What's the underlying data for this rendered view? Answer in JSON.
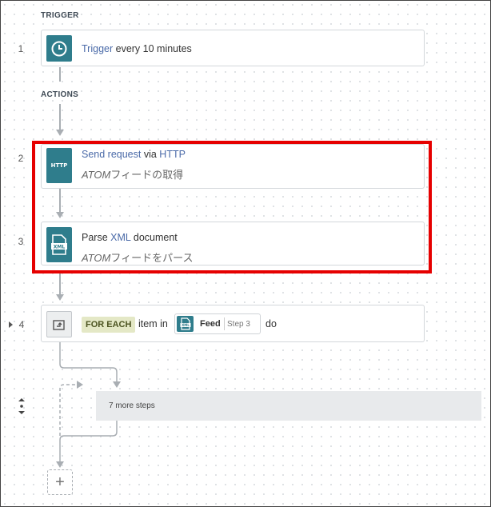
{
  "sections": {
    "trigger_label": "TRIGGER",
    "actions_label": "ACTIONS"
  },
  "steps": [
    {
      "number": "1",
      "icon": "clock-icon",
      "line1": {
        "prefix": "",
        "link1": "Trigger",
        "middle": " every 10 minutes",
        "link2": ""
      }
    },
    {
      "number": "2",
      "icon": "http-icon",
      "icon_text": "HTTP",
      "line1": {
        "link1": "Send request",
        "middle": " via ",
        "link2": "HTTP"
      },
      "line2": {
        "italic": "ATOM",
        "rest": "フィードの取得"
      }
    },
    {
      "number": "3",
      "icon": "xml-file-icon",
      "icon_text": "XML",
      "line1": {
        "prefix": "Parse ",
        "link1": "XML",
        "middle": " document"
      },
      "line2": {
        "italic": "ATOM",
        "rest": "フィードをパース"
      }
    },
    {
      "number": "4",
      "icon": "loop-icon",
      "foreach_badge": "FOR EACH",
      "item_in": "item in",
      "pill": {
        "icon": "xml-file-icon",
        "icon_text": "XML",
        "label": "Feed",
        "step": "Step 3"
      },
      "do": "do"
    }
  ],
  "collapsed": {
    "label": "7 more steps"
  },
  "add_button": {
    "icon": "plus-icon",
    "symbol": "+"
  },
  "colors": {
    "accent": "#2f7d8c",
    "link": "#4a6aa8",
    "highlight": "#e60000",
    "badge_bg": "#e4e8c6"
  }
}
